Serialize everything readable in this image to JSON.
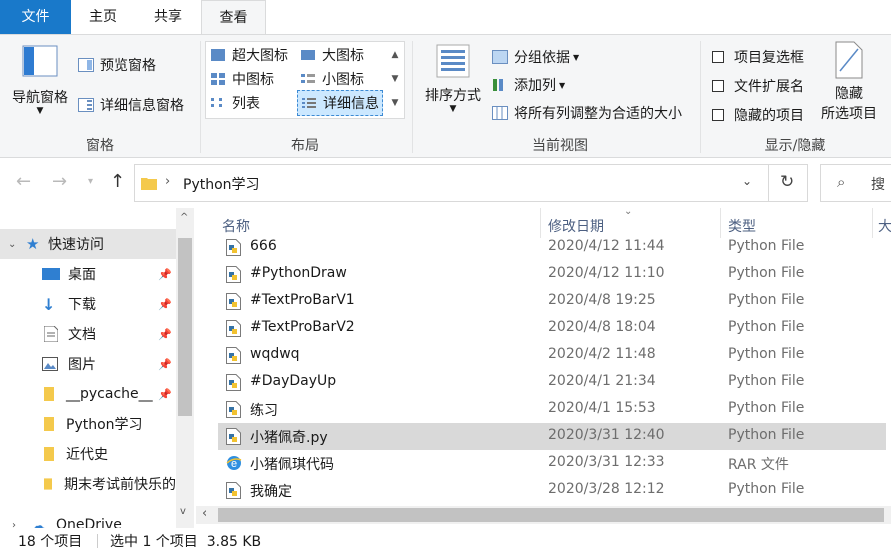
{
  "tabs": {
    "file": "文件",
    "home": "主页",
    "share": "共享",
    "view": "查看"
  },
  "ribbon": {
    "panes": {
      "nav_pane": "导航窗格",
      "preview": "预览窗格",
      "details": "详细信息窗格",
      "group": "窗格"
    },
    "layout": {
      "extra_large": "超大图标",
      "large": "大图标",
      "medium": "中图标",
      "small": "小图标",
      "list": "列表",
      "details": "详细信息",
      "group": "布局"
    },
    "current_view": {
      "sort_by": "排序方式",
      "group_by": "分组依据",
      "add_column": "添加列",
      "fit_columns": "将所有列调整为合适的大小",
      "group": "当前视图"
    },
    "show_hide": {
      "item_checkboxes": "项目复选框",
      "file_extensions": "文件扩展名",
      "hidden_items": "隐藏的项目",
      "hide_selected_1": "隐藏",
      "hide_selected_2": "所选项目",
      "group": "显示/隐藏"
    }
  },
  "address": {
    "path": "Python学习",
    "search_placeholder": "搜"
  },
  "nav": {
    "quick_access": "快速访问",
    "items": [
      {
        "label": "桌面",
        "icon": "desktop-icon",
        "pinned": true
      },
      {
        "label": "下载",
        "icon": "download-icon",
        "pinned": true
      },
      {
        "label": "文档",
        "icon": "document-icon",
        "pinned": true
      },
      {
        "label": "图片",
        "icon": "picture-icon",
        "pinned": true
      },
      {
        "label": "__pycache__",
        "icon": "folder-icon",
        "pinned": true
      },
      {
        "label": "Python学习",
        "icon": "folder-icon",
        "pinned": false
      },
      {
        "label": "近代史",
        "icon": "folder-icon",
        "pinned": false
      },
      {
        "label": "期末考试前快乐的",
        "icon": "folder-icon",
        "pinned": false
      }
    ],
    "onedrive": "OneDrive"
  },
  "columns": {
    "name": "名称",
    "date": "修改日期",
    "type": "类型",
    "size": "大"
  },
  "files": [
    {
      "name": "666",
      "date": "2020/4/12 11:44",
      "type": "Python File",
      "icon": "python-file-icon"
    },
    {
      "name": "#PythonDraw",
      "date": "2020/4/12 11:10",
      "type": "Python File",
      "icon": "python-file-icon"
    },
    {
      "name": "#TextProBarV1",
      "date": "2020/4/8 19:25",
      "type": "Python File",
      "icon": "python-file-icon"
    },
    {
      "name": "#TextProBarV2",
      "date": "2020/4/8 18:04",
      "type": "Python File",
      "icon": "python-file-icon"
    },
    {
      "name": "wqdwq",
      "date": "2020/4/2 11:48",
      "type": "Python File",
      "icon": "python-file-icon"
    },
    {
      "name": "#DayDayUp",
      "date": "2020/4/1 21:34",
      "type": "Python File",
      "icon": "python-file-icon"
    },
    {
      "name": "练习",
      "date": "2020/4/1 15:53",
      "type": "Python File",
      "icon": "python-file-icon"
    },
    {
      "name": "小猪佩奇.py",
      "date": "2020/3/31 12:40",
      "type": "Python File",
      "icon": "python-file-icon",
      "selected": true
    },
    {
      "name": "小猪佩琪代码",
      "date": "2020/3/31 12:33",
      "type": "RAR 文件",
      "icon": "ie-archive-icon"
    },
    {
      "name": "我确定",
      "date": "2020/3/28 12:12",
      "type": "Python File",
      "icon": "python-file-icon"
    }
  ],
  "status": {
    "count": "18 个项目",
    "selection": "选中 1 个项目  3.85 KB"
  },
  "colors": {
    "accent": "#1979ca",
    "selected_row": "#d9d9d9",
    "header_text": "#4d6082"
  }
}
